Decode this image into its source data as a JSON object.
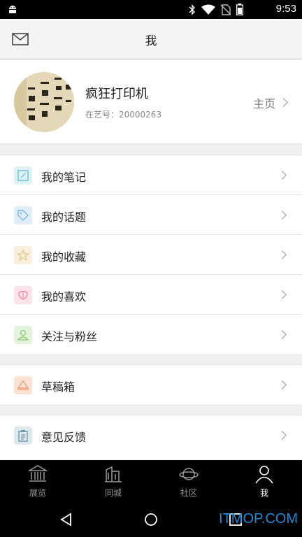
{
  "status_bar": {
    "time": "9:53",
    "icons": [
      "android-icon",
      "bluetooth-icon",
      "wifi-icon",
      "no-sim-icon",
      "battery-icon"
    ]
  },
  "header": {
    "title": "我",
    "left_icon": "mail-icon"
  },
  "profile": {
    "name": "疯狂打印机",
    "id_text": "在艺号：20000263",
    "home_label": "主页"
  },
  "menu_group_1": [
    {
      "label": "我的笔记",
      "icon": "note-icon",
      "color": "#6fc5cf"
    },
    {
      "label": "我的话题",
      "icon": "tag-icon",
      "color": "#7fb8e8"
    },
    {
      "label": "我的收藏",
      "icon": "star-icon",
      "color": "#e6c98b"
    },
    {
      "label": "我的喜欢",
      "icon": "flower-icon",
      "color": "#ee8fa8"
    },
    {
      "label": "关注与粉丝",
      "icon": "user-icon",
      "color": "#8fcd7c"
    }
  ],
  "menu_group_2": [
    {
      "label": "草稿箱",
      "icon": "draft-icon",
      "color": "#f0a078"
    }
  ],
  "menu_group_3": [
    {
      "label": "意见反馈",
      "icon": "clipboard-icon",
      "color": "#6e98a6"
    }
  ],
  "tabs": [
    {
      "label": "展览",
      "icon": "museum-icon",
      "active": false
    },
    {
      "label": "同城",
      "icon": "building-icon",
      "active": false
    },
    {
      "label": "社区",
      "icon": "planet-icon",
      "active": false
    },
    {
      "label": "我",
      "icon": "person-icon",
      "active": true
    }
  ],
  "watermark": "ITMOP.COM"
}
